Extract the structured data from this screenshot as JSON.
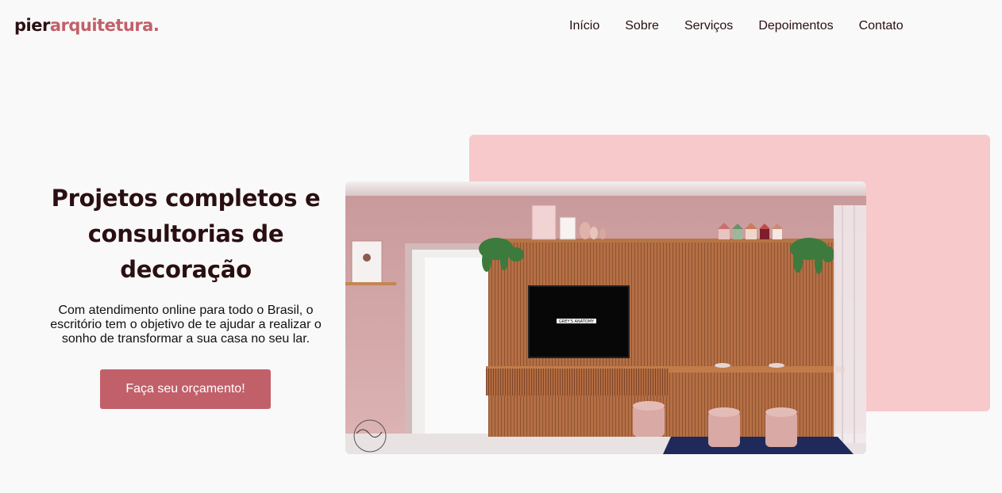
{
  "header": {
    "logo_part1": "pier",
    "logo_part2": "arquitetura."
  },
  "nav": {
    "items": [
      {
        "label": "Início"
      },
      {
        "label": "Sobre"
      },
      {
        "label": "Serviços"
      },
      {
        "label": "Depoimentos"
      },
      {
        "label": "Contato"
      }
    ]
  },
  "hero": {
    "title": "Projetos completos e consultorias de decoração",
    "description": "Com atendimento online para todo o Brasil, o escritório tem o objetivo de te ajudar a realizar o sonho de transformar a sua casa no seu lar.",
    "cta_label": "Faça seu orçamento!",
    "tv_text": "GREY'S ANATOMY"
  },
  "colors": {
    "brand_dark": "#2a0f12",
    "brand_accent": "#c2606a",
    "pink_block": "#f7c9cb",
    "background": "#f9f9f9"
  }
}
